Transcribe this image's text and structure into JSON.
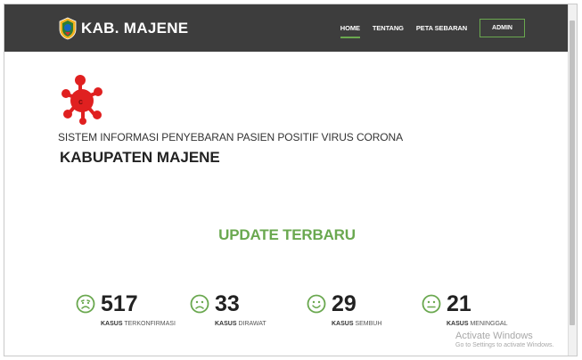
{
  "brand": {
    "name": "KAB. MAJENE"
  },
  "nav": {
    "items": [
      "HOME",
      "TENTANG",
      "PETA SEBARAN"
    ],
    "admin_label": "ADMIN"
  },
  "hero": {
    "subtitle": "SISTEM INFORMASI PENYEBARAN PASIEN POSITIF VIRUS CORONA",
    "title": "KABUPATEN MAJENE"
  },
  "update": {
    "title": "UPDATE TERBARU"
  },
  "stats": [
    {
      "value": "517",
      "label_bold": "KASUS",
      "label_rest": "TERKONFIRMASI",
      "icon": "worried-face-icon"
    },
    {
      "value": "33",
      "label_bold": "KASUS",
      "label_rest": "DIRAWAT",
      "icon": "sad-face-icon"
    },
    {
      "value": "29",
      "label_bold": "KASUS",
      "label_rest": "SEMBUH",
      "icon": "smile-face-icon"
    },
    {
      "value": "21",
      "label_bold": "KASUS",
      "label_rest": "MENINGGAL",
      "icon": "neutral-face-icon"
    }
  ],
  "watermark": {
    "title": "Activate Windows",
    "subtitle": "Go to Settings to activate Windows."
  },
  "colors": {
    "navbar": "#3d3d3d",
    "accent_green": "#6aa84f",
    "virus_red": "#e02020"
  }
}
